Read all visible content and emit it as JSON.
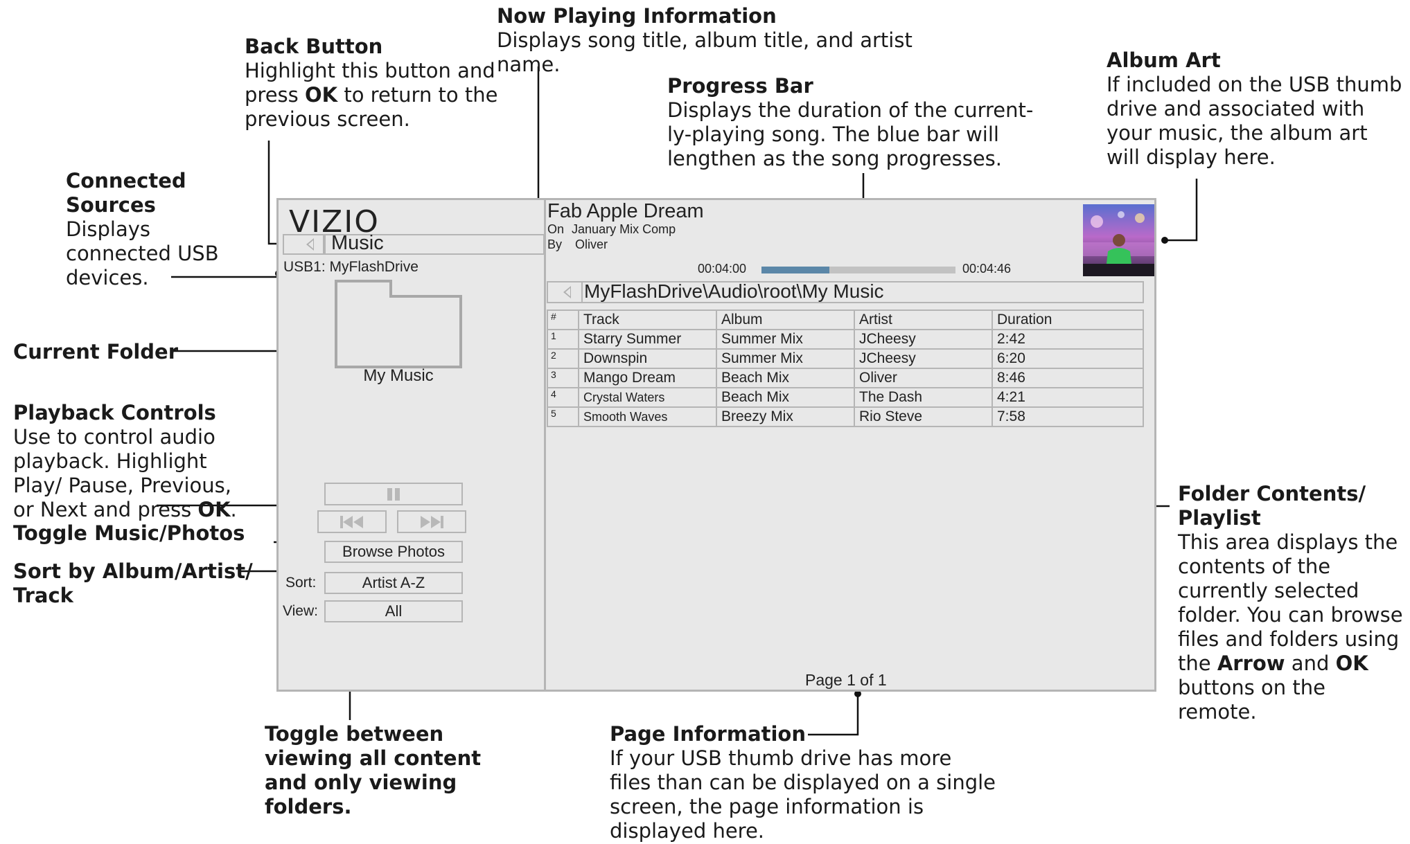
{
  "callouts": {
    "now_playing": {
      "title": "Now Playing Information",
      "text": "Displays song title, album title, and artist name."
    },
    "back_button": {
      "title": "Back Button",
      "text_1": "Highlight this button and press ",
      "bold": "OK",
      "text_2": " to return to the previous screen."
    },
    "progress_bar": {
      "title": "Progress Bar",
      "text": "Displays the duration of the current-ly-playing song. The blue bar will lengthen as the song progresses."
    },
    "album_art": {
      "title": "Album Art",
      "text": "If included on the USB thumb drive and associated with your music, the album art will display here."
    },
    "connected_sources": {
      "title": "Connected Sources",
      "text": "Displays connected USB devices."
    },
    "current_folder": {
      "title": "Current Folder"
    },
    "playback_controls": {
      "title": "Playback Controls",
      "text_1": "Use to control audio playback. Highlight Play/ Pause, Previous, or Next and press ",
      "bold": "OK",
      "text_2": "."
    },
    "toggle_music_photos": {
      "title": "Toggle Music/Photos"
    },
    "sort": {
      "title": "Sort by Album/Artist/\nTrack"
    },
    "folder_contents": {
      "title": "Folder Contents/\nPlaylist",
      "text_1": "This area displays the contents of the currently selected folder. You can browse files and folders using the ",
      "bold_1": "Arrow",
      "text_2": " and ",
      "bold_2": "OK",
      "text_3": " buttons on the remote."
    },
    "toggle_view": {
      "title": "Toggle between viewing all content and only viewing folders."
    },
    "page_info": {
      "title": "Page Information",
      "text": "If your USB thumb drive has more files than can be displayed on a single screen, the page information is displayed here."
    }
  },
  "screen": {
    "logo": "VIZIO",
    "nav_title": "Music",
    "source": "USB1: MyFlashDrive",
    "folder_label": "My Music",
    "browse_label": "Browse Photos",
    "sort_label": "Sort:",
    "sort_value": "Artist A-Z",
    "view_label": "View:",
    "view_value": "All",
    "now_playing": {
      "title": "Fab Apple Dream",
      "on_label": "On",
      "album": "January Mix Comp",
      "by_label": "By",
      "artist": "Oliver",
      "elapsed": "00:04:00",
      "total": "00:04:46",
      "progress_fraction": 0.35
    },
    "path": "MyFlashDrive\\Audio\\root\\My Music",
    "table": {
      "headers": [
        "#",
        "Track",
        "Album",
        "Artist",
        "Duration"
      ],
      "rows": [
        [
          "1",
          "Starry Summer",
          "Summer Mix",
          "JCheesy",
          "2:42"
        ],
        [
          "2",
          "Downspin",
          "Summer Mix",
          "JCheesy",
          "6:20"
        ],
        [
          "3",
          "Mango Dream",
          "Beach Mix",
          "Oliver",
          "8:46"
        ],
        [
          "4",
          "Crystal Waters",
          "Beach Mix",
          "The Dash",
          "4:21"
        ],
        [
          "5",
          "Smooth Waves",
          "Breezy Mix",
          "Rio Steve",
          "7:58"
        ]
      ]
    },
    "page_info": "Page 1 of 1"
  },
  "icons": {
    "back": "triangle-left-icon",
    "folder": "folder-icon",
    "pause": "pause-icon",
    "previous": "previous-icon",
    "next": "next-icon"
  },
  "colors": {
    "progress_fill": "#5b87a8",
    "progress_track": "#c2c2c2",
    "screen_bg": "#e8e8e8",
    "border": "#b5b5b5"
  }
}
